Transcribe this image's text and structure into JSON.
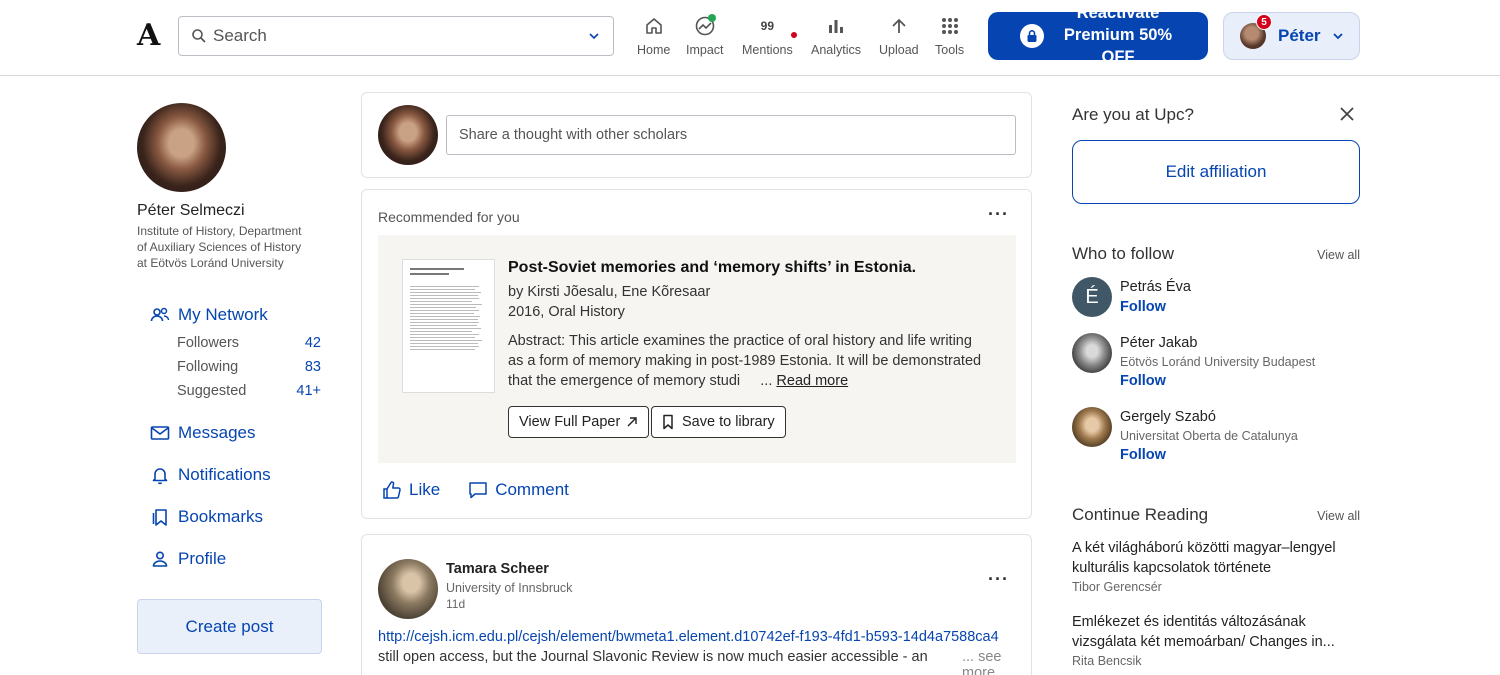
{
  "header": {
    "logo": "A",
    "search_placeholder": "Search",
    "nav": [
      {
        "label": "Home",
        "icon": "home-icon"
      },
      {
        "label": "Impact",
        "icon": "impact-icon"
      },
      {
        "label": "Mentions",
        "icon": "mentions-icon",
        "value": "99"
      },
      {
        "label": "Analytics",
        "icon": "analytics-icon"
      },
      {
        "label": "Upload",
        "icon": "upload-icon"
      },
      {
        "label": "Tools",
        "icon": "tools-icon"
      }
    ],
    "premium": {
      "line1": "Reactivate",
      "line2": "Premium 50%",
      "line3": "OFF"
    },
    "user": {
      "name": "Péter",
      "notifications": "5"
    }
  },
  "colors": {
    "accent": "#0645b1",
    "alert": "#d4001a",
    "positive": "#22a652"
  },
  "profile": {
    "name": "Péter Selmeczi",
    "affiliation": [
      "Institute of History, Department",
      "of Auxiliary Sciences of History",
      "at Eötvös Loránd University"
    ]
  },
  "left_nav": {
    "network": "My Network",
    "stats": [
      {
        "label": "Followers",
        "value": "42"
      },
      {
        "label": "Following",
        "value": "83"
      },
      {
        "label": "Suggested",
        "value": "41+"
      }
    ],
    "messages": "Messages",
    "notifications": "Notifications",
    "bookmarks": "Bookmarks",
    "profile": "Profile",
    "create_post": "Create post"
  },
  "share": {
    "placeholder": "Share a thought with other scholars"
  },
  "recommended": {
    "heading": "Recommended for you",
    "title": "Post-Soviet memories and ‘memory shifts’ in Estonia.",
    "authors": "by Kirsti Jõesalu, Ene Kõresaar",
    "year_journal": "2016, Oral History",
    "abstract_1": "Abstract: This article examines the practice of oral history and life writing",
    "abstract_2": "as a form of memory making in post-1989 Estonia. It will be demonstrated",
    "abstract_3": "that the emergence of memory studi",
    "ellipsis": "...",
    "read_more": "Read more",
    "view_full": "View Full Paper",
    "save": "Save to library",
    "like": "Like",
    "comment": "Comment"
  },
  "post": {
    "author": "Tamara Scheer",
    "affiliation": "University of Innsbruck",
    "time": "11d",
    "link": "http://cejsh.icm.edu.pl/cejsh/element/bwmeta1.element.d10742ef-f193-4fd1-b593-14d4a7588ca4",
    "text": "still open access, but the Journal Slavonic Review is now much easier accessible - an",
    "see_more": "... see more"
  },
  "affiliation_prompt": {
    "question": "Are you at Upc?",
    "button": "Edit affiliation"
  },
  "who_to_follow": {
    "heading": "Who to follow",
    "view_all": "View all",
    "people": [
      {
        "name": "Petrás Éva",
        "initial": "É",
        "affiliation": "",
        "action": "Follow"
      },
      {
        "name": "Péter Jakab",
        "affiliation": "Eötvös Loránd University Budapest",
        "action": "Follow"
      },
      {
        "name": "Gergely Szabó",
        "affiliation": "Universitat Oberta de Catalunya",
        "action": "Follow"
      }
    ]
  },
  "continue_reading": {
    "heading": "Continue Reading",
    "view_all": "View all",
    "items": [
      {
        "title_1": "A két világháború közötti magyar–lengyel",
        "title_2": "kulturális kapcsolatok története",
        "author": "Tibor Gerencsér"
      },
      {
        "title_1": "Emlékezet és identitás változásának",
        "title_2": "vizsgálata két memoárban/ Changes in...",
        "author": "Rita Bencsik"
      }
    ]
  }
}
